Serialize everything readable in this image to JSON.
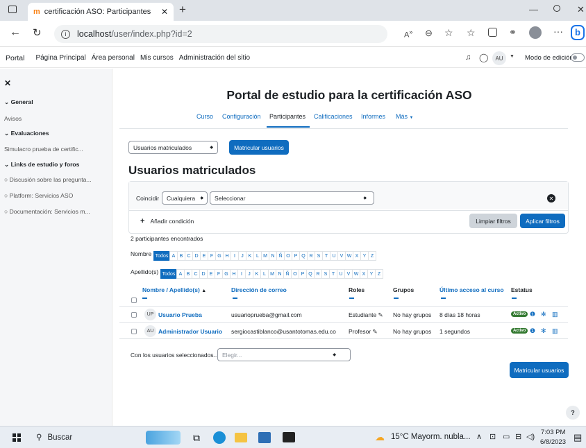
{
  "browser": {
    "tab_title": "certificación ASO: Participantes",
    "url_host": "localhost",
    "url_path": "/user/index.php?id=2"
  },
  "navbar": {
    "site": "Portal",
    "links": [
      "Página Principal",
      "Área personal",
      "Mis cursos",
      "Administración del sitio"
    ],
    "user_initials": "AU",
    "edit_mode": "Modo de edición"
  },
  "sidebar": {
    "section1": "General",
    "item_avisos": "Avisos",
    "section2": "Evaluaciones",
    "item_simulacro": "Simulacro prueba de certific...",
    "section3": "Links de estudio y foros",
    "item_discusion": "Discusión sobre las pregunta...",
    "item_platform": "Platform: Servicios ASO",
    "item_documentacion": "Documentación: Servicios m..."
  },
  "page": {
    "title": "Portal de estudio para la certificación ASO",
    "tabs": [
      "Curso",
      "Configuración",
      "Participantes",
      "Calificaciones",
      "Informes",
      "Más"
    ],
    "active_tab": "Participantes",
    "select_users": "Usuarios matriculados",
    "enrol_button": "Matricular usuarios",
    "heading": "Usuarios matriculados"
  },
  "filter": {
    "match_label": "Coincidir",
    "match_value": "Cualquiera",
    "select_placeholder": "Seleccionar",
    "add_condition": "Añadir condición",
    "clear_button": "Limpiar filtros",
    "apply_button": "Aplicar filtros"
  },
  "results": {
    "count_text": "2 participantes encontrados",
    "firstname_label": "Nombre",
    "lastname_label": "Apellido(s)",
    "all_label": "Todos",
    "letters": [
      "A",
      "B",
      "C",
      "D",
      "E",
      "F",
      "G",
      "H",
      "I",
      "J",
      "K",
      "L",
      "M",
      "N",
      "Ñ",
      "O",
      "P",
      "Q",
      "R",
      "S",
      "T",
      "U",
      "V",
      "W",
      "X",
      "Y",
      "Z"
    ]
  },
  "table": {
    "headers": {
      "name": "Nombre / Apellido(s)",
      "email": "Dirección de correo",
      "roles": "Roles",
      "groups": "Grupos",
      "last_access": "Último acceso al curso",
      "status": "Estatus"
    },
    "rows": [
      {
        "initials": "UP",
        "name": "Usuario Prueba",
        "email": "usuarioprueba@gmail.com",
        "role": "Estudiante",
        "groups": "No hay grupos",
        "last_access": "8 días 18 horas",
        "status": "Activo"
      },
      {
        "initials": "AU",
        "name": "Administrador Usuario",
        "email": "sergiocastiblanco@usantotomas.edu.co",
        "role": "Profesor",
        "groups": "No hay grupos",
        "last_access": "1 segundos",
        "status": "Activo"
      }
    ]
  },
  "bulk": {
    "label": "Con los usuarios seleccionados...",
    "select_placeholder": "Elegir...",
    "enrol_button": "Matricular usuarios"
  },
  "help_button": "?",
  "taskbar": {
    "search": "Buscar",
    "weather": "15°C Mayorm. nubla...",
    "time": "7:03 PM",
    "date": "6/8/2023"
  },
  "colors": {
    "primary": "#0f6cbf",
    "active_badge": "#357a32",
    "sidebar_bg": "#f5f6f8"
  }
}
